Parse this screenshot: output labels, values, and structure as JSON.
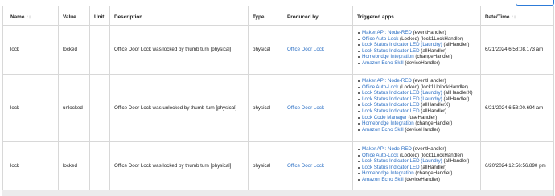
{
  "columns": {
    "name": "Name",
    "name_sort": "↑↓",
    "value": "Value",
    "unit": "Unit",
    "description": "Description",
    "type": "Type",
    "produced_by": "Produced by",
    "triggered_apps": "Triggered apps",
    "datetime": "Date/Time",
    "datetime_sort": "↑↓"
  },
  "rows": [
    {
      "name": "lock",
      "value": "locked",
      "unit": "",
      "description": "Office Door Lock was locked by thumb turn [physical]",
      "type": "physical",
      "produced_by": "Office Door Lock",
      "datetime": "6/21/2024 6:58:08.173 am",
      "apps": [
        {
          "link": "Maker API: Node-RED",
          "handler": " (eventHandler)"
        },
        {
          "link": "Office Auto-Lock",
          "handler": " (Locked) (lock1LockHandler)"
        },
        {
          "link": "Lock Status Indicator LED (Laundry)",
          "handler": " (allHandler)"
        },
        {
          "link": "Lock Status Indicator LED",
          "handler": " (allHandler)"
        },
        {
          "link": "Homebridge Integration",
          "handler": " (changeHandler)"
        },
        {
          "link": "Amazon Echo Skill",
          "handler": " (deviceHandler)"
        }
      ]
    },
    {
      "name": "lock",
      "value": "unlocked",
      "unit": "",
      "description": "Office Door Lock was unlocked by thumb turn [physical]",
      "type": "physical",
      "produced_by": "Office Door Lock",
      "datetime": "6/21/2024 6:58:00.694 am",
      "apps": [
        {
          "link": "Maker API: Node-RED",
          "handler": " (eventHandler)"
        },
        {
          "link": "Office Auto-Lock",
          "handler": " (Locked) (lock1UnlockHandler)"
        },
        {
          "link": "Lock Status Indicator LED (Laundry)",
          "handler": " (allHandlerX)"
        },
        {
          "link": "Lock Status Indicator LED (Laundry)",
          "handler": " (allHandler)"
        },
        {
          "link": "Lock Status Indicator LED",
          "handler": " (allHandlerX)"
        },
        {
          "link": "Lock Status Indicator LED",
          "handler": " (allHandler)"
        },
        {
          "link": "Lock Code Manager",
          "handler": " (useHandler)"
        },
        {
          "link": "Homebridge Integration",
          "handler": " (changeHandler)"
        },
        {
          "link": "Amazon Echo Skill",
          "handler": " (deviceHandler)"
        }
      ]
    },
    {
      "name": "lock",
      "value": "locked",
      "unit": "",
      "description": "Office Door Lock was locked by thumb turn [physical]",
      "type": "physical",
      "produced_by": "Office Door Lock",
      "datetime": "6/20/2024 12:56:56.890 pm",
      "apps": [
        {
          "link": "Maker API: Node-RED",
          "handler": " (eventHandler)"
        },
        {
          "link": "Office Auto-Lock",
          "handler": " (Locked) (lock1LockHandler)"
        },
        {
          "link": "Lock Status Indicator LED (Laundry)",
          "handler": " (allHandler)"
        },
        {
          "link": "Lock Status Indicator LED",
          "handler": " (allHandler)"
        },
        {
          "link": "Homebridge Integration",
          "handler": " (changeHandler)"
        },
        {
          "link": "Amazon Echo Skill",
          "handler": " (deviceHandler)"
        }
      ]
    }
  ]
}
